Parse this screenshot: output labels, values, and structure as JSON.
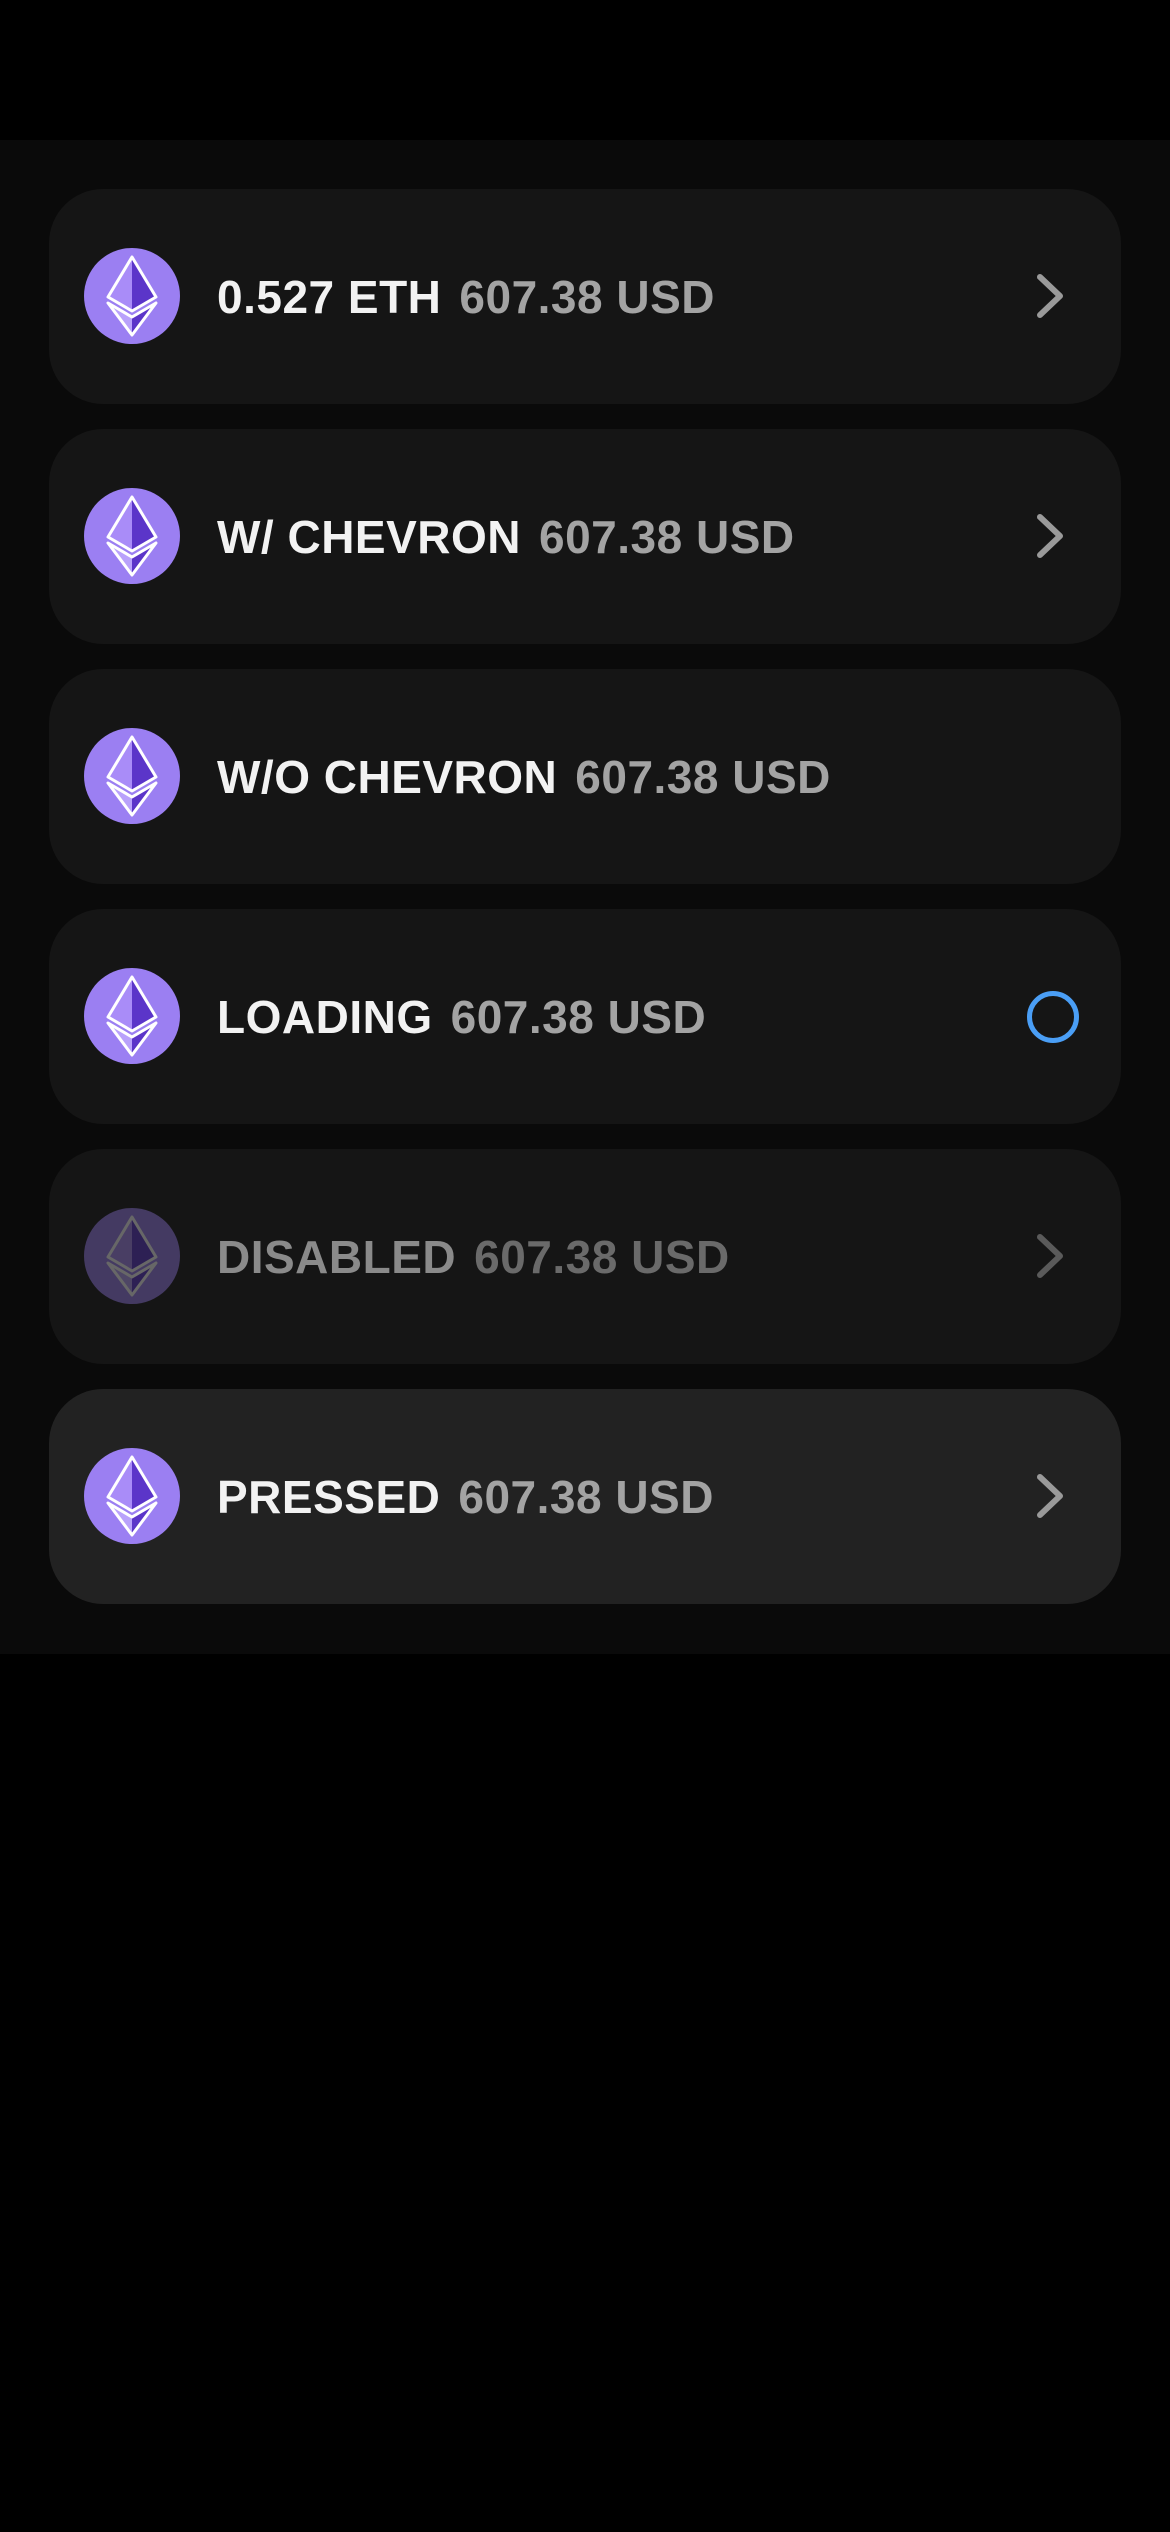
{
  "rows": [
    {
      "label": "0.527 ETH",
      "amount": "607.38 USD",
      "state": "default",
      "trailing": "chevron"
    },
    {
      "label": "W/ CHEVRON",
      "amount": "607.38 USD",
      "state": "default",
      "trailing": "chevron"
    },
    {
      "label": "W/O CHEVRON",
      "amount": "607.38 USD",
      "state": "default",
      "trailing": "none"
    },
    {
      "label": "LOADING",
      "amount": "607.38 USD",
      "state": "loading",
      "trailing": "spinner"
    },
    {
      "label": "DISABLED",
      "amount": "607.38 USD",
      "state": "disabled",
      "trailing": "chevron"
    },
    {
      "label": "PRESSED",
      "amount": "607.38 USD",
      "state": "pressed",
      "trailing": "chevron"
    }
  ],
  "icons": {
    "coin": "ethereum-icon",
    "chevron": "chevron-right-icon",
    "spinner": "loading-spinner-icon"
  },
  "colors": {
    "background": "#000000",
    "panel": "#0a0a0a",
    "row": "#151515",
    "row_pressed": "#222222",
    "coin": "#9b7ff2",
    "label": "#f2f2f2",
    "amount": "#a3a3a3",
    "spinner": "#4a9ef5"
  }
}
